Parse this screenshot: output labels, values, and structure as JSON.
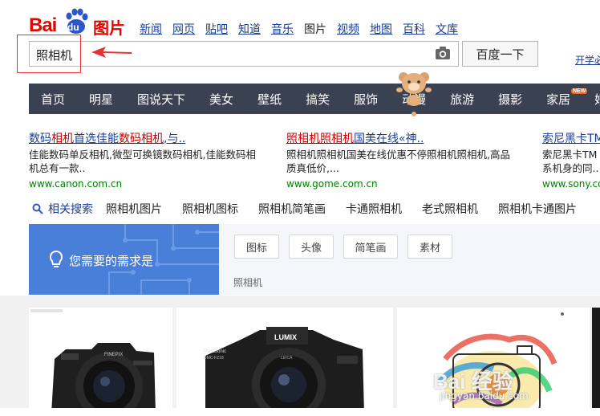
{
  "logo": {
    "bai": "Bai",
    "du": "du",
    "tupian": "图片"
  },
  "top_nav": [
    {
      "label": "新闻",
      "active": false
    },
    {
      "label": "网页",
      "active": false
    },
    {
      "label": "贴吧",
      "active": false
    },
    {
      "label": "知道",
      "active": false
    },
    {
      "label": "音乐",
      "active": false
    },
    {
      "label": "图片",
      "active": true
    },
    {
      "label": "视频",
      "active": false
    },
    {
      "label": "地图",
      "active": false
    },
    {
      "label": "百科",
      "active": false
    },
    {
      "label": "文库",
      "active": false
    }
  ],
  "search": {
    "value": "照相机",
    "button_label": "百度一下",
    "camera_icon": "camera-icon"
  },
  "header_right": {
    "register_link": "开学必"
  },
  "categories": [
    "首页",
    "明星",
    "图说天下",
    "美女",
    "壁纸",
    "搞笑",
    "服饰",
    "动漫",
    "旅游",
    "摄影",
    "家居",
    "婚"
  ],
  "new_badge": "NEW",
  "ads": [
    {
      "title_parts": [
        {
          "text": "数码",
          "color": "blue"
        },
        {
          "text": "相机",
          "color": "red"
        },
        {
          "text": "首选佳能",
          "color": "blue"
        },
        {
          "text": "数码相机",
          "color": "red"
        },
        {
          "text": ",与..",
          "color": "blue"
        }
      ],
      "desc": "佳能数码单反相机,微型可换镜数码相机,佳能数码相机总有一款..",
      "url": "www.canon.com.cn"
    },
    {
      "title_parts": [
        {
          "text": "照相机照相机",
          "color": "red"
        },
        {
          "text": "国美在线«神..",
          "color": "blue"
        }
      ],
      "desc": "照相机照相机国美在线优惠不停照相机照相机,高品质真低价,...",
      "url": "www.gome.com.cn"
    },
    {
      "title_parts": [
        {
          "text": "索尼黑卡TM",
          "color": "blue"
        }
      ],
      "desc": "索尼黑卡TM系机身的同..",
      "url": "www.sony.co"
    }
  ],
  "related": {
    "label": "相关搜索",
    "items": [
      "照相机图片",
      "照相机图标",
      "照相机简笔画",
      "卡通照相机",
      "老式照相机",
      "照相机卡通图片"
    ]
  },
  "need_panel": {
    "title": "您需要的需求是",
    "tags": [
      "图标",
      "头像",
      "简笔画",
      "素材"
    ],
    "keyword": "照相机"
  },
  "image_labels": {
    "camera1_brand": "FINEPIX",
    "camera2_brand": "LUMIX",
    "camera2_maker": "Panasonic",
    "camera2_model": "DMC-FZ18",
    "camera2_lens": "LEICA"
  },
  "watermark": {
    "text": "Bai 经验",
    "url": "jingyan.baidu.com"
  },
  "colors": {
    "brand_red": "#e10602",
    "link_blue": "#1a3d96",
    "catbar_bg": "#3a4150",
    "need_blue": "#4a7fd9",
    "url_green": "#008000"
  }
}
